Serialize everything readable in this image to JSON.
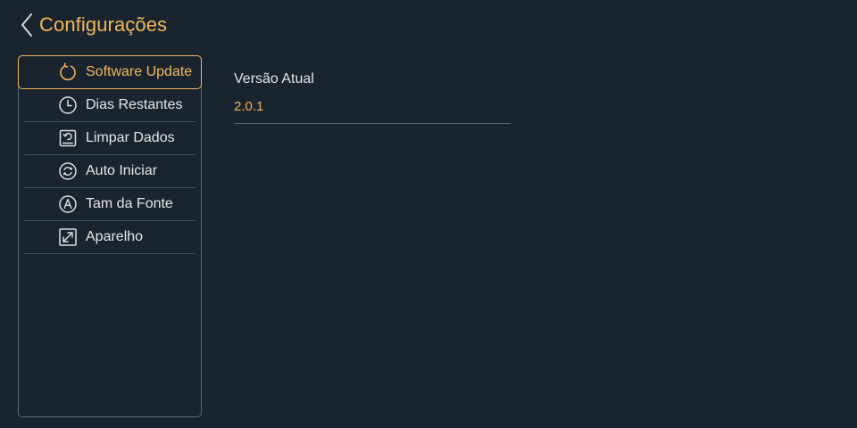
{
  "header": {
    "title": "Configurações",
    "back_icon": "chevron-left-icon"
  },
  "sidebar": {
    "items": [
      {
        "label": "Software Update",
        "icon": "refresh-icon",
        "active": true
      },
      {
        "label": "Dias Restantes",
        "icon": "clock-icon",
        "active": false
      },
      {
        "label": "Limpar Dados",
        "icon": "clear-data-icon",
        "active": false
      },
      {
        "label": "Auto Iniciar",
        "icon": "auto-start-icon",
        "active": false
      },
      {
        "label": "Tam da Fonte",
        "icon": "font-size-icon",
        "active": false
      },
      {
        "label": "Aparelho",
        "icon": "resize-icon",
        "active": false
      }
    ]
  },
  "main": {
    "version_label": "Versão Atual",
    "version_value": "2.0.1"
  },
  "colors": {
    "background": "#1a242e",
    "accent": "#f2b65a",
    "text": "#e6e6e6",
    "divider": "#46525c"
  }
}
